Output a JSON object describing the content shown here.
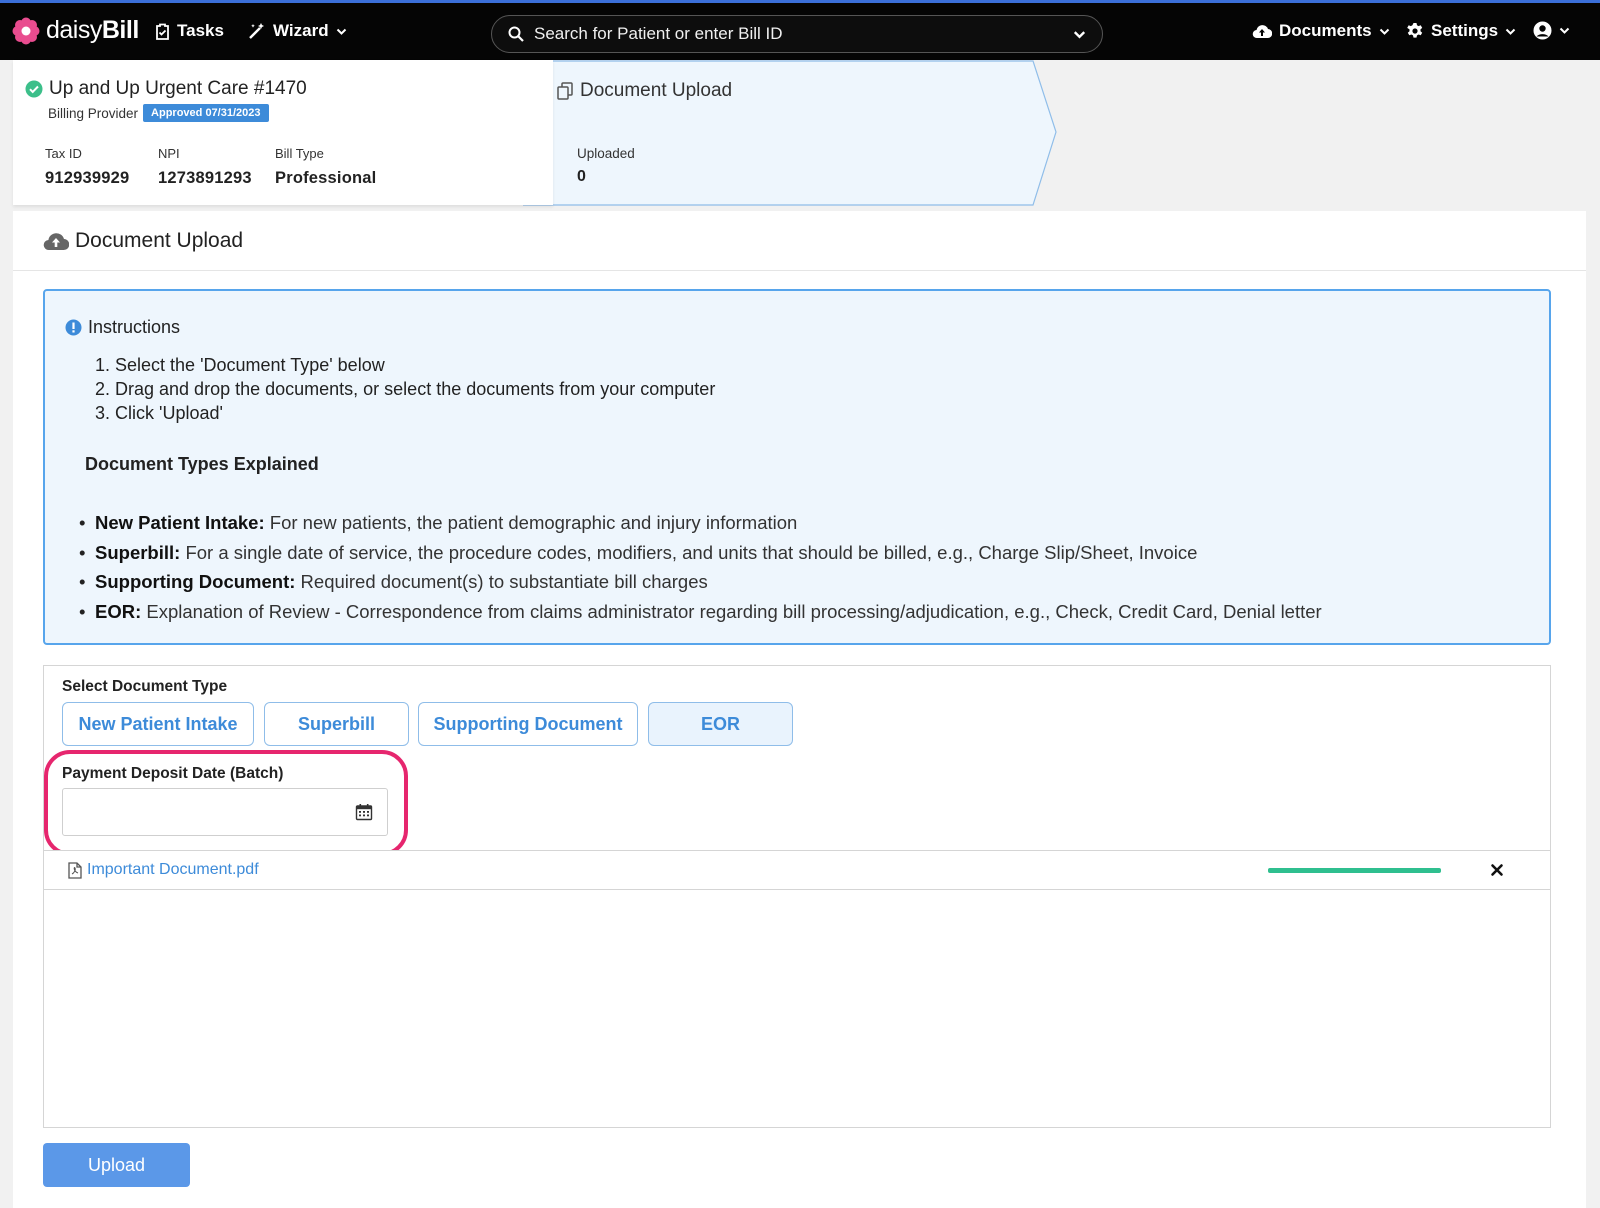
{
  "nav": {
    "brand_light": "daisy",
    "brand_bold": "Bill",
    "tasks": "Tasks",
    "wizard": "Wizard",
    "search_placeholder": "Search for Patient or enter Bill ID",
    "documents": "Documents",
    "settings": "Settings"
  },
  "provider": {
    "name": "Up and Up Urgent Care #1470",
    "role": "Billing Provider",
    "badge": "Approved 07/31/2023",
    "tax_id_label": "Tax ID",
    "tax_id": "912939929",
    "npi_label": "NPI",
    "npi": "1273891293",
    "bill_type_label": "Bill Type",
    "bill_type": "Professional"
  },
  "upload_summary": {
    "title": "Document Upload",
    "uploaded_label": "Uploaded",
    "uploaded_count": "0"
  },
  "main": {
    "title": "Document Upload",
    "instructions": {
      "title": "Instructions",
      "steps": [
        "1. Select the 'Document Type' below",
        "2. Drag and drop the documents, or select the documents from your computer",
        "3. Click 'Upload'"
      ],
      "types_heading": "Document Types Explained",
      "types": [
        {
          "term": "New Patient Intake:",
          "desc": " For new patients, the patient demographic and injury information"
        },
        {
          "term": "Superbill:",
          "desc": " For a single date of service, the procedure codes, modifiers, and units that should be billed, e.g., Charge Slip/Sheet, Invoice"
        },
        {
          "term": "Supporting Document:",
          "desc": " Required document(s) to substantiate bill charges"
        },
        {
          "term": "EOR:",
          "desc": " Explanation of Review - Correspondence from claims administrator regarding bill processing/adjudication, e.g., Check, Credit Card, Denial letter"
        }
      ]
    },
    "select_label": "Select Document Type",
    "doc_types": [
      "New Patient Intake",
      "Superbill",
      "Supporting Document",
      "EOR"
    ],
    "selected_type": "EOR",
    "payment_date_label": "Payment Deposit Date (Batch)",
    "payment_date_value": "",
    "file": {
      "name": "Important Document.pdf",
      "progress": 1.0
    },
    "upload_button": "Upload"
  },
  "colors": {
    "accent": "#3d8bd9",
    "highlight": "#e6266e",
    "progress": "#2fbf8f",
    "info_bg": "#eef6fd"
  }
}
